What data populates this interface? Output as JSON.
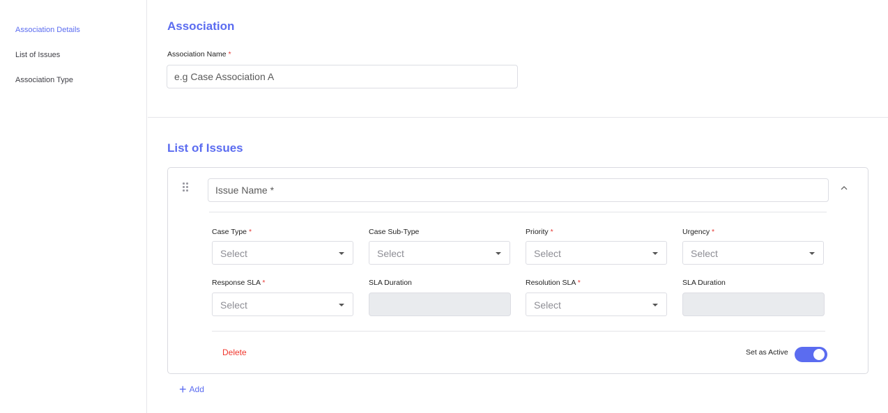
{
  "sidebar": {
    "items": [
      {
        "label": "Association Details",
        "active": true
      },
      {
        "label": "List of Issues",
        "active": false
      },
      {
        "label": "Association Type",
        "active": false
      }
    ]
  },
  "association": {
    "title": "Association",
    "name_label": "Association Name",
    "required_mark": "*",
    "name_placeholder": "e.g Case Association A",
    "name_value": ""
  },
  "issues": {
    "title": "List of Issues",
    "issue_name_placeholder": "Issue Name *",
    "fields": {
      "case_type": {
        "label": "Case Type",
        "required": "*",
        "placeholder": "Select"
      },
      "case_sub_type": {
        "label": "Case Sub-Type",
        "placeholder": "Select"
      },
      "priority": {
        "label": "Priority",
        "required": "*",
        "placeholder": "Select"
      },
      "urgency": {
        "label": "Urgency",
        "required": "*",
        "placeholder": "Select"
      },
      "response_sla": {
        "label": "Response SLA",
        "required": "*",
        "placeholder": "Select"
      },
      "response_sla_duration": {
        "label": "SLA Duration"
      },
      "resolution_sla": {
        "label": "Resolution SLA",
        "required": "*",
        "placeholder": "Select"
      },
      "resolution_sla_duration": {
        "label": "SLA Duration"
      }
    },
    "delete_label": "Delete",
    "active_label": "Set as Active",
    "active_on": true,
    "add_label": "Add"
  },
  "colors": {
    "accent": "#5b6cf0",
    "required": "#e53935",
    "delete": "#f0362c",
    "disabled_fill": "#e9ebee"
  },
  "icons": [
    "drag-handle-icon",
    "chevron-up-icon",
    "caret-down-icon",
    "plus-icon"
  ]
}
